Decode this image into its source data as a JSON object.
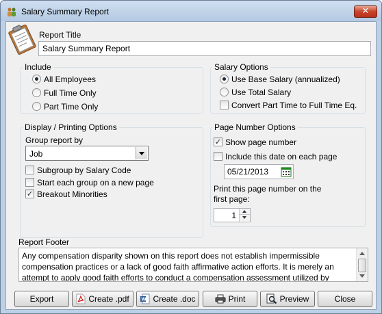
{
  "window": {
    "title": "Salary Summary Report",
    "close_label": "✕"
  },
  "report_title": {
    "label": "Report Title",
    "value": "Salary Summary Report"
  },
  "include": {
    "title": "Include",
    "options": [
      {
        "label": "All Employees",
        "selected": true
      },
      {
        "label": "Full Time Only",
        "selected": false
      },
      {
        "label": "Part Time Only",
        "selected": false
      }
    ]
  },
  "salary_options": {
    "title": "Salary Options",
    "options": [
      {
        "label": "Use Base Salary (annualized)",
        "selected": true
      },
      {
        "label": "Use Total Salary",
        "selected": false
      }
    ],
    "convert_label": "Convert Part Time to Full Time Eq.",
    "convert_checked": false
  },
  "display": {
    "title": "Display / Printing Options",
    "group_by_label": "Group report by",
    "group_by_value": "Job",
    "subgroup_label": "Subgroup by Salary Code",
    "newpage_label": "Start each group on a new page",
    "minorities_label": "Breakout Minorities",
    "minorities_check": "✓"
  },
  "page_number": {
    "title": "Page Number Options",
    "show_label": "Show page number",
    "show_check": "✓",
    "include_date_label": "Include this date on each page",
    "date_value": "05/21/2013",
    "print_label_1": "Print this page number on the",
    "print_label_2": "first page:",
    "first_page_value": "1"
  },
  "footer": {
    "label": "Report Footer",
    "text": "Any compensation disparity shown on this report does not establish impermissible compensation practices or a lack of good faith affirmative action efforts.  It is merely an attempt to apply good faith efforts to conduct a compensation assessment utilized by"
  },
  "buttons": {
    "export": "Export",
    "pdf": "Create .pdf",
    "doc": "Create .doc",
    "print": "Print",
    "preview": "Preview",
    "close": "Close"
  },
  "icons": {
    "app": "people-icon",
    "clipboard": "clipboard-icon",
    "pdf": "pdf-file-icon",
    "doc": "word-doc-icon",
    "print": "printer-icon",
    "preview": "magnifier-icon",
    "calendar": "calendar-icon"
  }
}
